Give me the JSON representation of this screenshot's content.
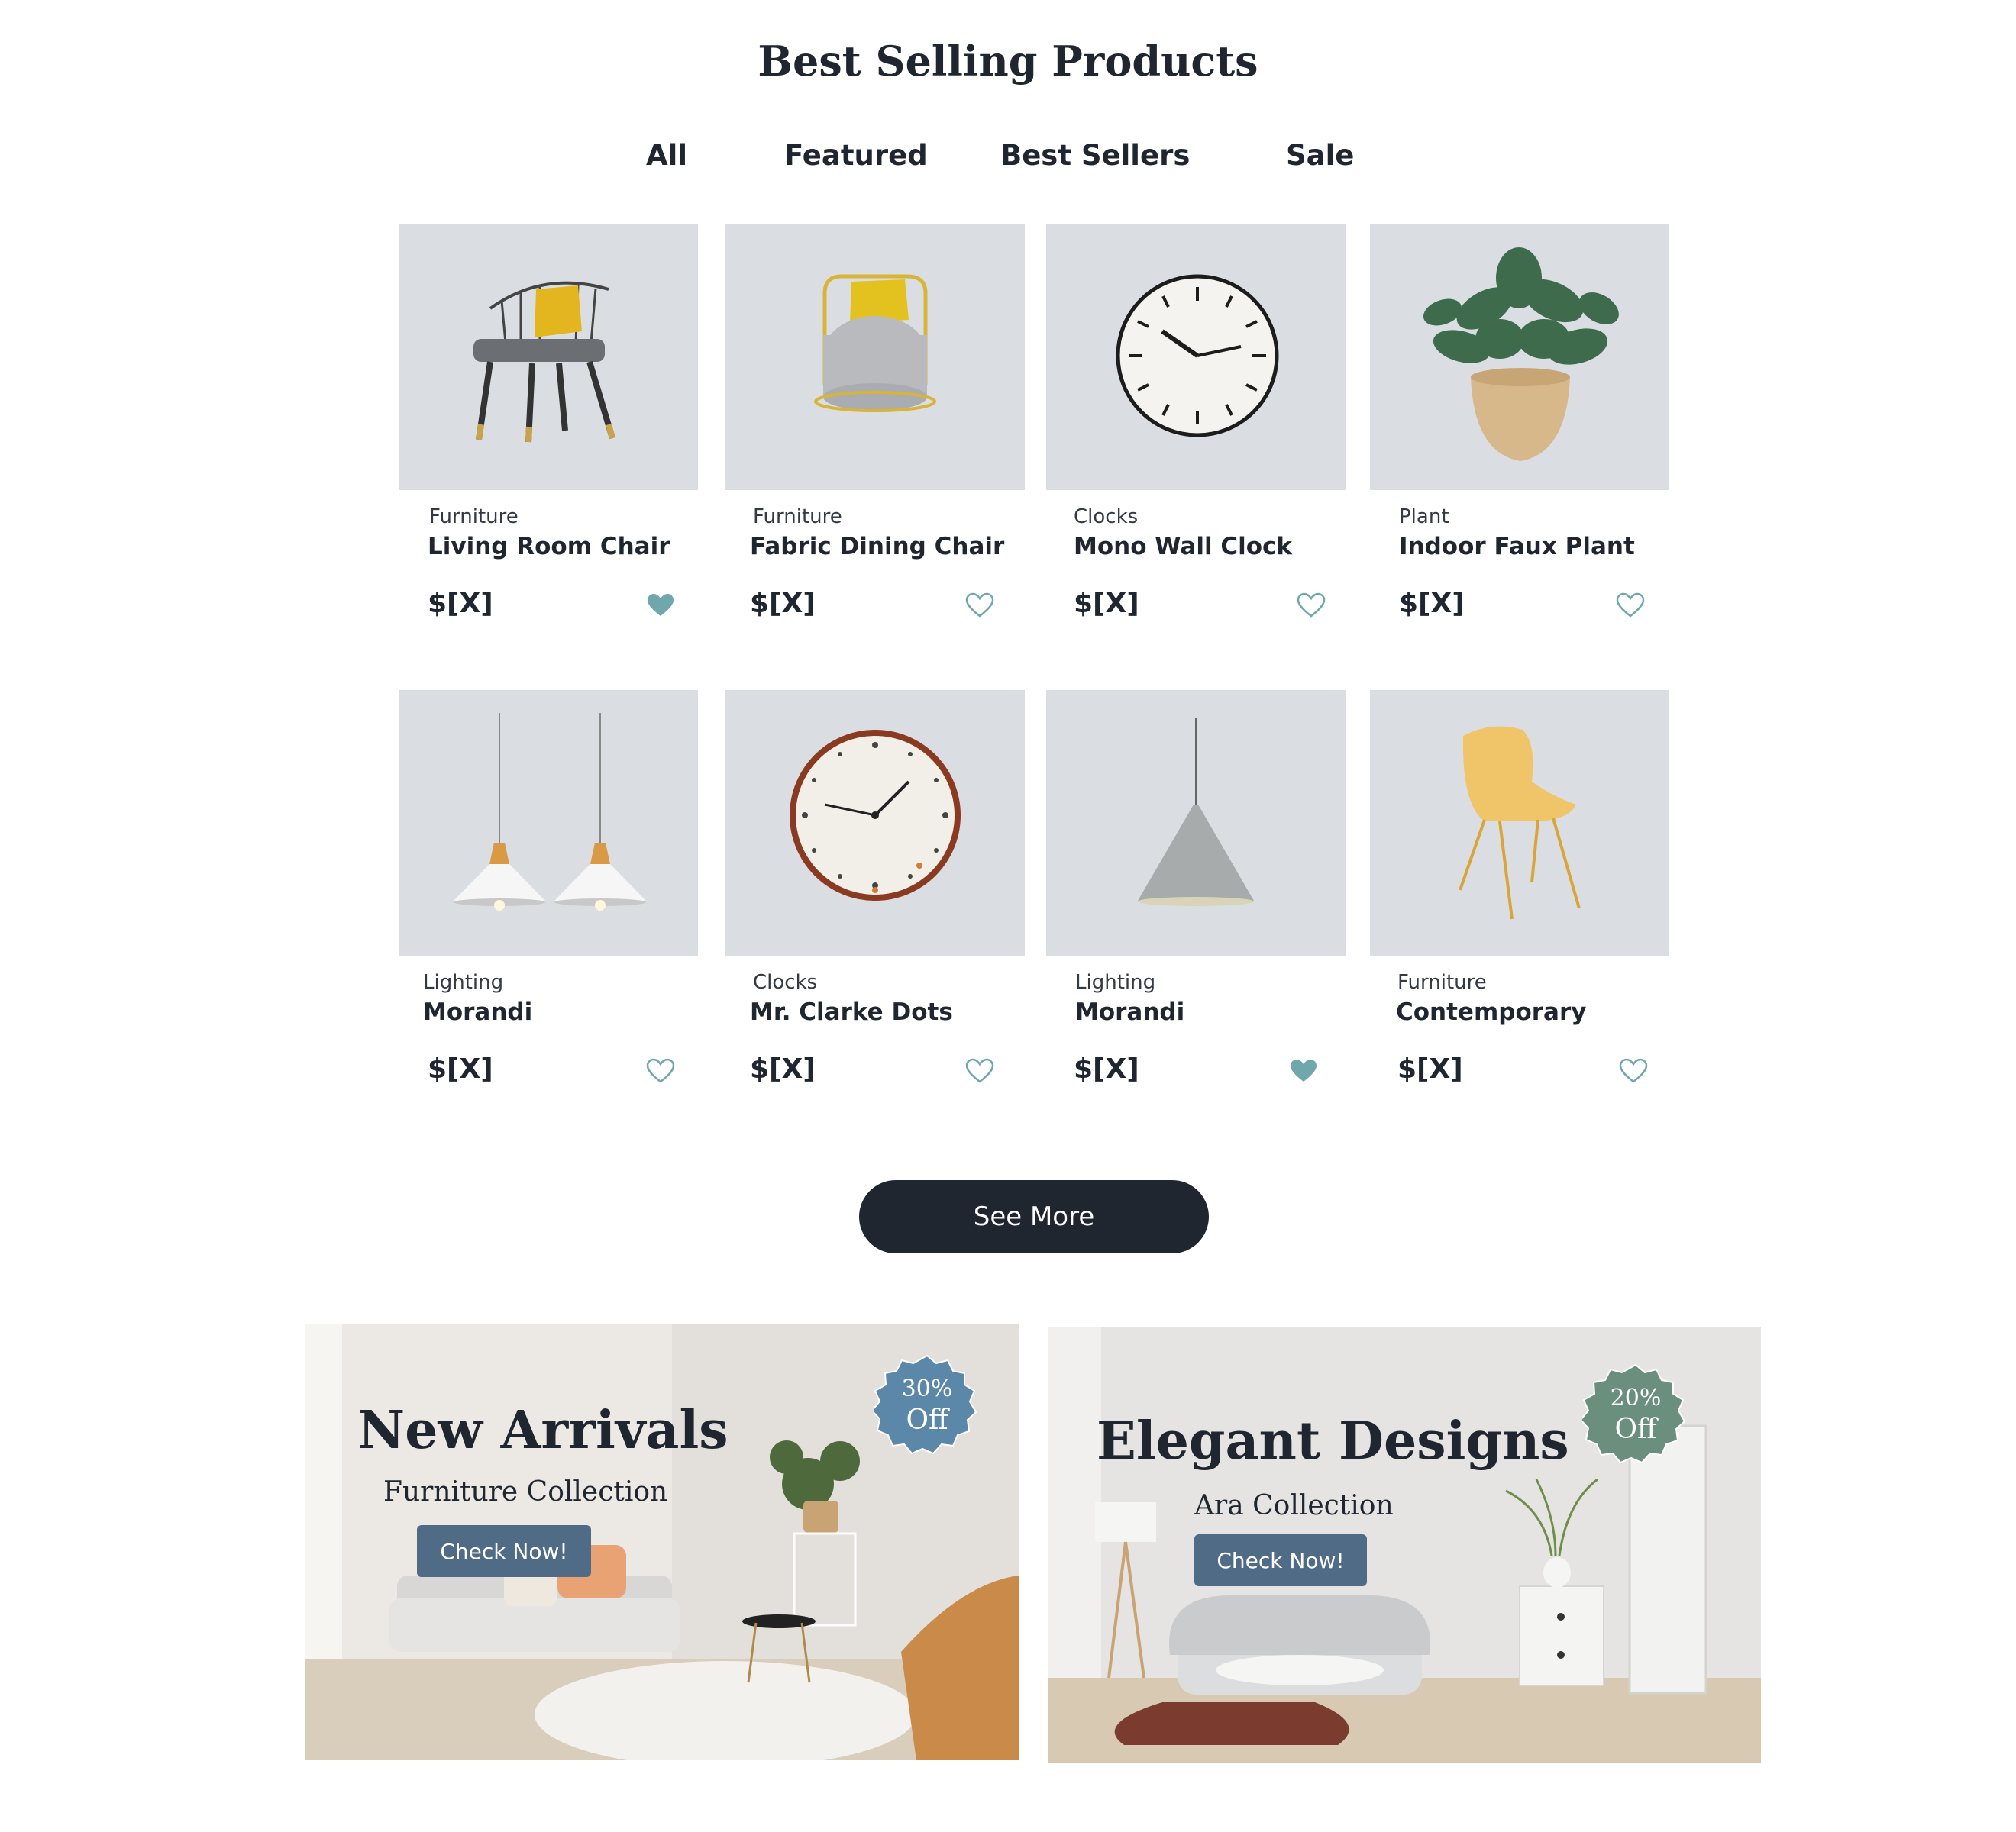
{
  "section": {
    "title": "Best Selling Products"
  },
  "tabs": [
    {
      "label": "All"
    },
    {
      "label": "Featured"
    },
    {
      "label": "Best Sellers"
    },
    {
      "label": "Sale"
    }
  ],
  "products": [
    {
      "category": "Furniture",
      "name": "Living Room Chair",
      "price": "$[X]",
      "favorited": true,
      "image_icon": "chair-icon"
    },
    {
      "category": "Furniture",
      "name": "Fabric Dining Chair",
      "price": "$[X]",
      "favorited": false,
      "image_icon": "chair-icon"
    },
    {
      "category": "Clocks",
      "name": "Mono Wall Clock",
      "price": "$[X]",
      "favorited": false,
      "image_icon": "clock-icon"
    },
    {
      "category": "Plant",
      "name": "Indoor Faux Plant",
      "price": "$[X]",
      "favorited": false,
      "image_icon": "plant-icon"
    },
    {
      "category": "Lighting",
      "name": "Morandi",
      "price": "$[X]",
      "favorited": false,
      "image_icon": "lamp-icon"
    },
    {
      "category": "Clocks",
      "name": "Mr. Clarke Dots",
      "price": "$[X]",
      "favorited": false,
      "image_icon": "clock-icon"
    },
    {
      "category": "Lighting",
      "name": "Morandi",
      "price": "$[X]",
      "favorited": true,
      "image_icon": "lamp-icon"
    },
    {
      "category": "Furniture",
      "name": "Contemporary",
      "price": "$[X]",
      "favorited": false,
      "image_icon": "chair-icon"
    }
  ],
  "see_more": {
    "label": "See More"
  },
  "banners": [
    {
      "title": "New Arrivals",
      "subtitle": "Furniture Collection",
      "button": "Check Now!",
      "badge_percent": "30%",
      "badge_off": "Off",
      "badge_color": "#5b87a8"
    },
    {
      "title": "Elegant Designs",
      "subtitle": "Ara Collection",
      "button": "Check Now!",
      "badge_percent": "20%",
      "badge_off": "Off",
      "badge_color": "#6a8f7c"
    }
  ],
  "colors": {
    "text_dark": "#1f2630",
    "card_background": "#dadee2",
    "heart_accent": "#6fa7ad",
    "button_dark": "#1f2630",
    "banner_button": "#4f6b85"
  }
}
